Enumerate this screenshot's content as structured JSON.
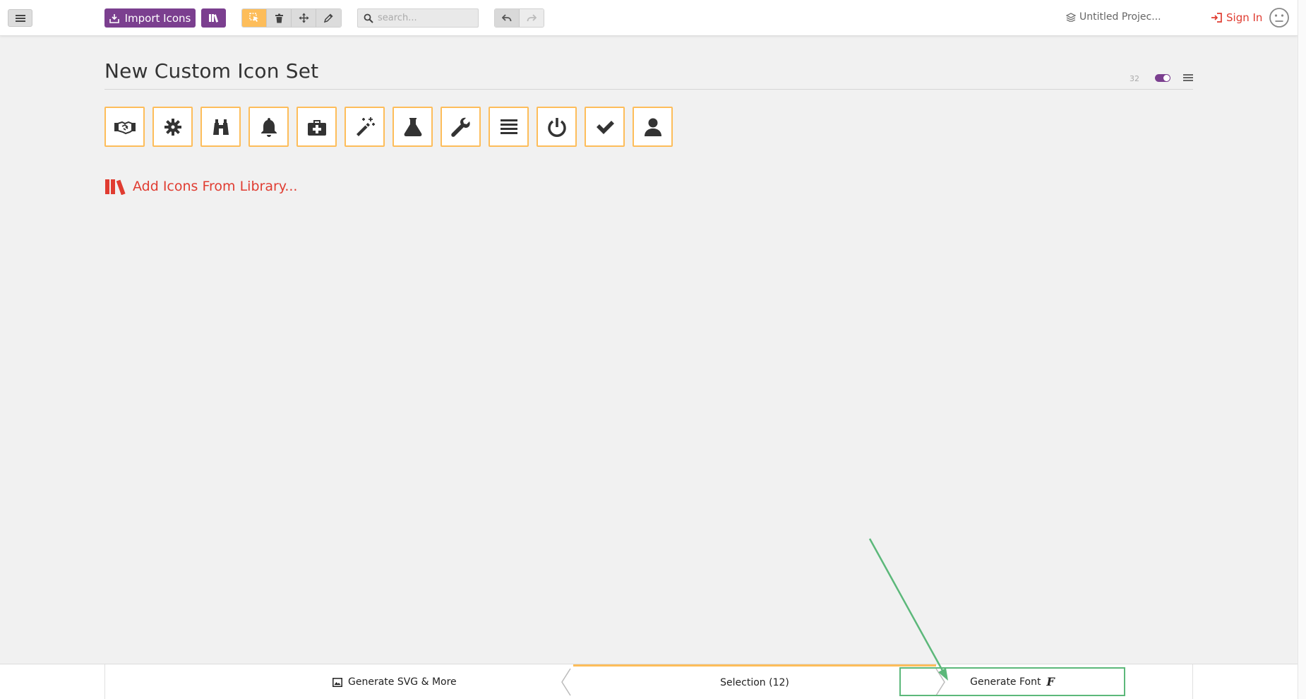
{
  "toolbar": {
    "menu_icon": "hamburger-icon",
    "import_label": "Import Icons",
    "import_icon": "download-tray-icon",
    "library_icon": "books-icon",
    "tools": [
      "select-icon",
      "trash-icon",
      "move-icon",
      "pencil-icon"
    ],
    "active_tool": "select",
    "search_placeholder": "search...",
    "undo_icon": "undo-icon",
    "redo_icon": "redo-icon"
  },
  "header_right": {
    "project_name": "Untitled Projec...",
    "project_icon": "layers-icon",
    "signin_label": "Sign In",
    "signin_icon": "sign-in-icon",
    "avatar_icon": "neutral-face-icon"
  },
  "icon_set": {
    "title": "New Custom Icon Set",
    "grid_size": "32",
    "glyphs": [
      "handshake",
      "cog",
      "binoculars",
      "bell",
      "aid-kit",
      "magic-wand",
      "lab-flask",
      "wrench",
      "list",
      "power",
      "checkmark",
      "user"
    ]
  },
  "library": {
    "add_label": "Add Icons From Library..."
  },
  "bottom": {
    "generate_svg_label": "Generate SVG & More",
    "selection_label": "Selection (12)",
    "generate_font_label": "Generate Font",
    "font_glyph": "F"
  },
  "colors": {
    "accent_purple": "#7b3f8f",
    "accent_orange": "#fdbd5a",
    "accent_red": "#e03c31",
    "annotation_green": "#5cb87a"
  }
}
